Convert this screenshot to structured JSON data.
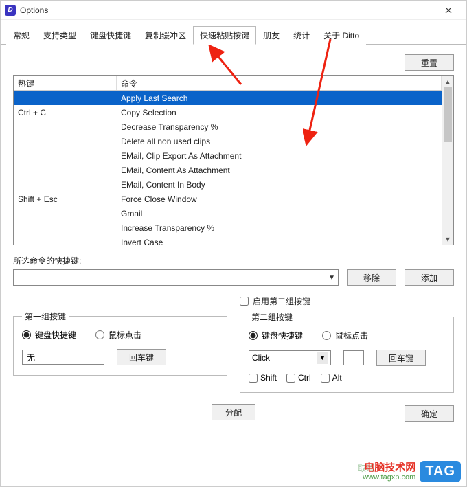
{
  "window": {
    "title": "Options"
  },
  "tabs": [
    "常规",
    "支持类型",
    "键盘快捷键",
    "复制缓冲区",
    "快速粘贴按键",
    "朋友",
    "统计",
    "关于 Ditto"
  ],
  "active_tab_index": 4,
  "buttons": {
    "reset": "重置",
    "remove": "移除",
    "add": "添加",
    "enter": "回车键",
    "assign": "分配",
    "ok": "确定",
    "cancel": "取消"
  },
  "table": {
    "headers": {
      "hotkey": "热键",
      "command": "命令"
    },
    "rows": [
      {
        "hotkey": "",
        "command": "Apply Last Search",
        "selected": true
      },
      {
        "hotkey": "Ctrl + C",
        "command": "Copy Selection"
      },
      {
        "hotkey": "",
        "command": "Decrease Transparency %"
      },
      {
        "hotkey": "",
        "command": "Delete all non used clips"
      },
      {
        "hotkey": "",
        "command": "EMail, Clip Export As Attachment"
      },
      {
        "hotkey": "",
        "command": "EMail, Content As Attachment"
      },
      {
        "hotkey": "",
        "command": "EMail, Content In Body"
      },
      {
        "hotkey": "Shift + Esc",
        "command": "Force Close Window"
      },
      {
        "hotkey": "",
        "command": "Gmail"
      },
      {
        "hotkey": "",
        "command": "Increase Transparency %"
      },
      {
        "hotkey": "",
        "command": "Invert Case"
      }
    ]
  },
  "selected_label": "所选命令的快捷键:",
  "group2_enable": "启用第二组按键",
  "group1": {
    "legend": "第一组按键",
    "radio_keyboard": "键盘快捷键",
    "radio_mouse": "鼠标点击",
    "input_value": "无"
  },
  "group2": {
    "legend": "第二组按键",
    "radio_keyboard": "键盘快捷键",
    "radio_mouse": "鼠标点击",
    "select_value": "Click",
    "mods": {
      "shift": "Shift",
      "ctrl": "Ctrl",
      "alt": "Alt"
    }
  },
  "watermark": {
    "line1": "电脑技术网",
    "line2": "www.tagxp.com",
    "tag": "TAG"
  }
}
